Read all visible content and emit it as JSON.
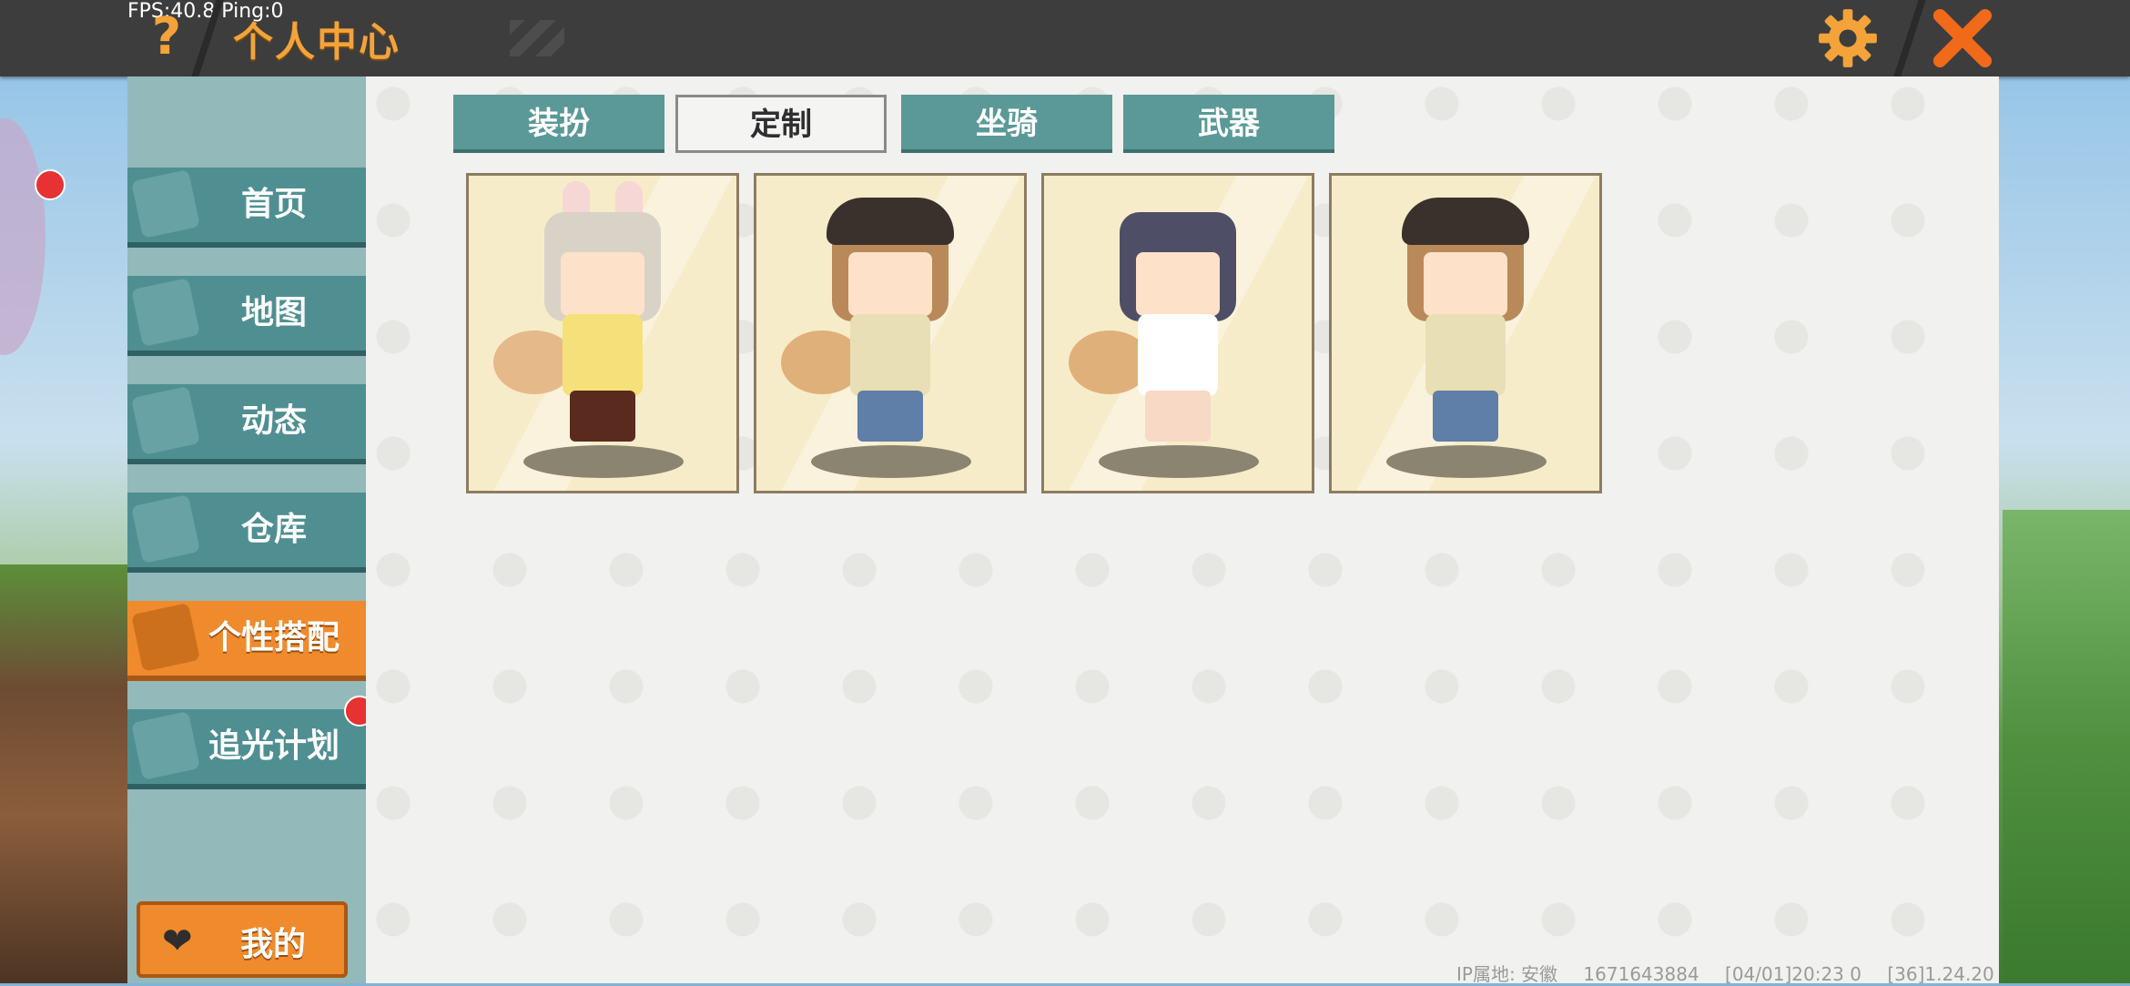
{
  "hud": {
    "fps": "FPS:40.8",
    "ping": "Ping:0"
  },
  "header": {
    "title": "个人中心",
    "help_glyph": "?"
  },
  "sidebar": {
    "items": [
      {
        "label": "首页",
        "icon": "home-icon",
        "badge": false
      },
      {
        "label": "地图",
        "icon": "map-icon",
        "badge": false
      },
      {
        "label": "动态",
        "icon": "bell-icon",
        "badge": false
      },
      {
        "label": "仓库",
        "icon": "warehouse-icon",
        "badge": false
      },
      {
        "label": "个性搭配",
        "icon": "outfit-icon",
        "active": true,
        "badge": false
      },
      {
        "label": "追光计划",
        "icon": "plan-icon",
        "badge": true
      }
    ],
    "mine": {
      "label": "我的",
      "icon": "heart-icon"
    }
  },
  "tabs": [
    {
      "label": "装扮"
    },
    {
      "label": "定制",
      "active": true
    },
    {
      "label": "坐骑"
    },
    {
      "label": "武器"
    }
  ],
  "cards": [
    {
      "name": "bunny-girl-outfit"
    },
    {
      "name": "captain-hat-outfit"
    },
    {
      "name": "husky-hood-outfit"
    },
    {
      "name": "captain-hat-outfit-alt"
    }
  ],
  "footer": {
    "ip_location": "IP属地: 安徽",
    "uid": "1671643884",
    "datetime": "[04/01]20:23 0",
    "version": "[36]1.24.20"
  },
  "colors": {
    "accent": "#ef8b2c",
    "teal": "#4f8f92",
    "title": "#f3a33a",
    "badge": "#e63232"
  }
}
